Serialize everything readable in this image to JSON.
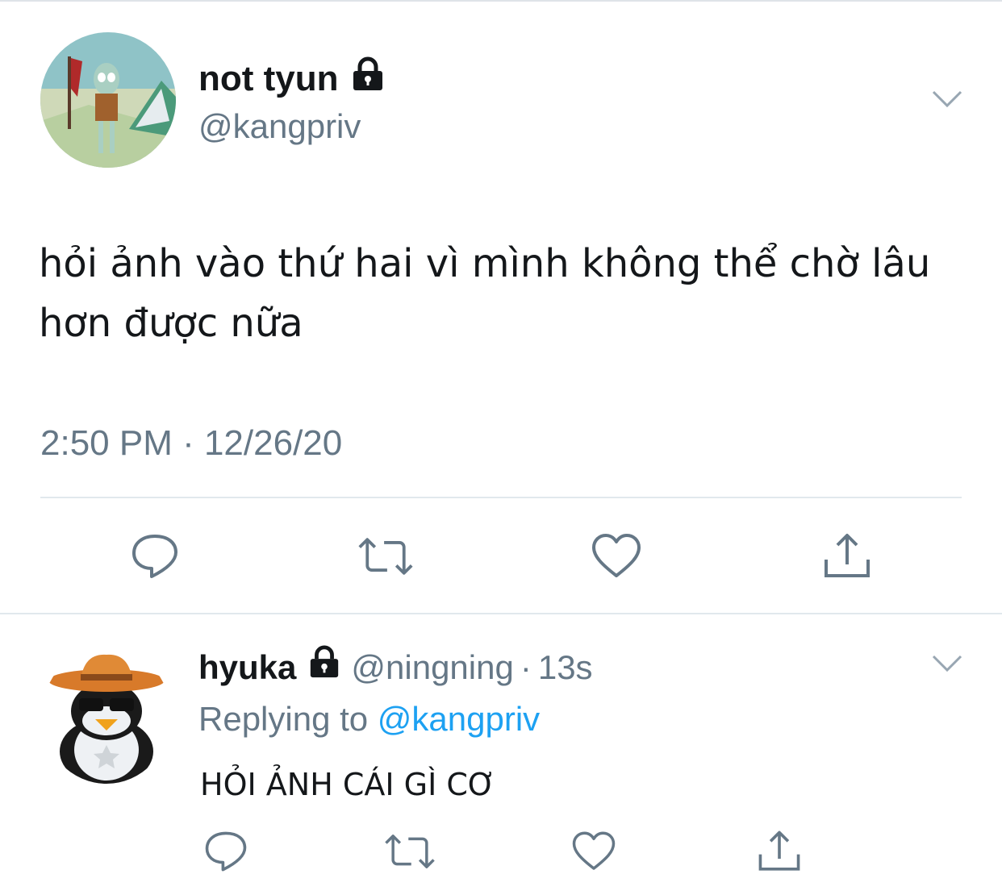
{
  "tweet": {
    "display_name": "not tyun",
    "handle": "@kangpriv",
    "text": "hỏi ảnh vào thứ hai vì mình không thể chờ lâu hơn được nữa",
    "timestamp": "2:50 PM · 12/26/20",
    "verified_icon": "lock-icon"
  },
  "reply": {
    "display_name": "hyuka",
    "handle": "@ningning",
    "time_sep": "·",
    "time": "13s",
    "replying_prefix": "Replying to",
    "replying_to": "@kangpriv",
    "text": "HỎI ẢNH CÁI GÌ CƠ"
  },
  "actions": [
    "reply-icon",
    "retweet-icon",
    "like-icon",
    "share-icon"
  ],
  "colors": {
    "text": "#14171a",
    "secondary": "#657786",
    "accent": "#1da1f2",
    "divider": "#e1e8ed"
  }
}
